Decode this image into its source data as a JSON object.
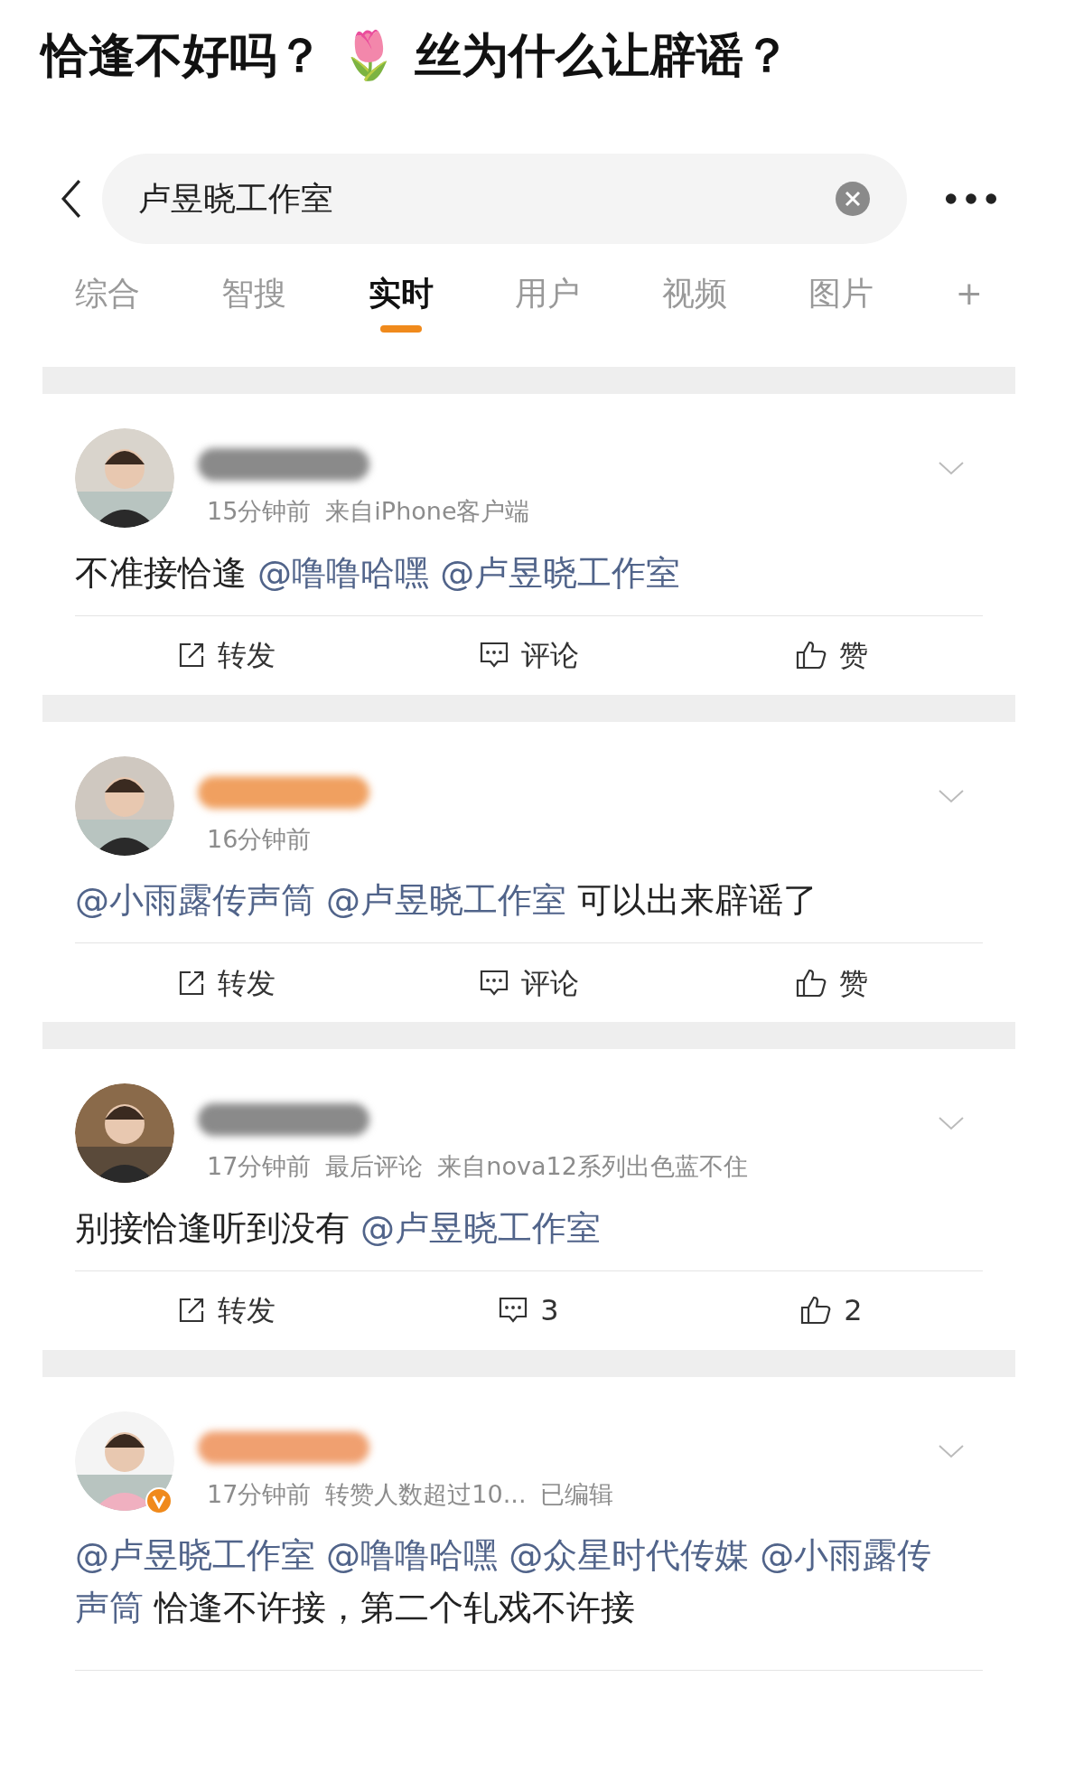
{
  "headline": "恰逢不好吗？ 🌷 丝为什么让辟谣？",
  "search": {
    "value": "卢昱晓工作室"
  },
  "tabs": [
    {
      "label": "综合",
      "selected": false
    },
    {
      "label": "智搜",
      "selected": false
    },
    {
      "label": "实时",
      "selected": true
    },
    {
      "label": "用户",
      "selected": false
    },
    {
      "label": "视频",
      "selected": false
    },
    {
      "label": "图片",
      "selected": false
    },
    {
      "label": "+",
      "selected": false
    }
  ],
  "posts": [
    {
      "color": "#8a8a8a",
      "verified": false,
      "meta": [
        "15分钟前",
        "来自iPhone客户端"
      ],
      "text": [
        {
          "kind": "plain",
          "text": "不准接恰逢"
        },
        {
          "kind": "mention",
          "text": "@噜噜哈嘿"
        },
        {
          "kind": "mention",
          "text": "@卢昱晓工作室"
        }
      ],
      "actions": [
        {
          "kind": "repost",
          "label": "转发"
        },
        {
          "kind": "comment",
          "label": "评论"
        },
        {
          "kind": "like",
          "label": "赞"
        }
      ]
    },
    {
      "color": "#f0a060",
      "verified": false,
      "meta": [
        "16分钟前"
      ],
      "text": [
        {
          "kind": "mention",
          "text": "@小雨露传声筒"
        },
        {
          "kind": "mention",
          "text": "@卢昱晓工作室"
        },
        {
          "kind": "plain",
          "text": "可以出来辟谣了"
        }
      ],
      "actions": [
        {
          "kind": "repost",
          "label": "转发"
        },
        {
          "kind": "comment",
          "label": "评论"
        },
        {
          "kind": "like",
          "label": "赞"
        }
      ]
    },
    {
      "color": "#8a8a8a",
      "verified": false,
      "meta": [
        "17分钟前",
        "最后评论",
        "来自nova12系列出色蓝不住"
      ],
      "text": [
        {
          "kind": "plain",
          "text": "别接恰逢听到没有"
        },
        {
          "kind": "mention",
          "text": "@卢昱晓工作室"
        }
      ],
      "actions": [
        {
          "kind": "repost",
          "label": "转发"
        },
        {
          "kind": "comment",
          "label": "3"
        },
        {
          "kind": "like",
          "label": "2"
        }
      ]
    },
    {
      "color": "#f0a070",
      "verified": true,
      "meta": [
        "17分钟前",
        "转赞人数超过10...",
        "已编辑"
      ],
      "text": [
        {
          "kind": "mention",
          "text": "@卢昱晓工作室"
        },
        {
          "kind": "mention",
          "text": "@噜噜哈嘿"
        },
        {
          "kind": "mention",
          "text": "@众星时代传媒"
        },
        {
          "kind": "mention",
          "text": "@小雨露传声筒"
        },
        {
          "kind": "plain",
          "text": "恰逢不许接，第二个轧戏不许接"
        }
      ]
    }
  ]
}
